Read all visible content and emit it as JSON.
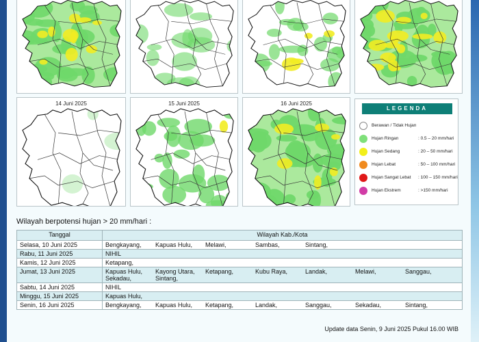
{
  "maps": [
    {
      "id": "m10",
      "date": ""
    },
    {
      "id": "m11",
      "date": ""
    },
    {
      "id": "m12",
      "date": ""
    },
    {
      "id": "m13",
      "date": ""
    },
    {
      "id": "m14",
      "date": "14 Juni 2025"
    },
    {
      "id": "m15",
      "date": "15 Juni 2025"
    },
    {
      "id": "m16",
      "date": "16 Juni 2025"
    }
  ],
  "legend": {
    "title": "LEGENDA",
    "items": [
      {
        "label": "Berawan / Tidak Hujan",
        "range": "",
        "color": "#ffffff"
      },
      {
        "label": "Hujan Ringan",
        "range": ": 0.5 – 20 mm/hari",
        "color": "#7fe07a"
      },
      {
        "label": "Hujan Sedang",
        "range": ": 20 – 50 mm/hari",
        "color": "#f2ef1a"
      },
      {
        "label": "Hujan Lebat",
        "range": ": 50 – 100 mm/hari",
        "color": "#f08a1e"
      },
      {
        "label": "Hujan Sangat Lebat",
        "range": ": 100 – 150 mm/hari",
        "color": "#e01818"
      },
      {
        "label": "Hujan Ekstrem",
        "range": ": >150 mm/hari",
        "color": "#d13ca6"
      }
    ]
  },
  "section_title": "Wilayah berpotensi hujan > 20 mm/hari :",
  "table": {
    "headers": [
      "Tanggal",
      "Wilayah Kab./Kota"
    ],
    "rows": [
      {
        "date": "Selasa, 10 Juni 2025",
        "regions": [
          "Bengkayang,",
          "Kapuas Hulu,",
          "Melawi,",
          "Sambas,",
          "Sintang,"
        ]
      },
      {
        "date": "Rabu, 11 Juni 2025",
        "regions": [
          "NIHIL"
        ]
      },
      {
        "date": "Kamis, 12 Juni 2025",
        "regions": [
          "Ketapang,"
        ]
      },
      {
        "date": "Jumat, 13 Juni 2025",
        "regions": [
          "Kapuas Hulu,",
          "Kayong Utara,",
          "Ketapang,",
          "Kubu Raya,",
          "Landak,",
          "Melawi,",
          "Sanggau,",
          "Sekadau,",
          "Sintang,"
        ]
      },
      {
        "date": "Sabtu, 14 Juni 2025",
        "regions": [
          "NIHIL"
        ]
      },
      {
        "date": "Minggu, 15 Juni 2025",
        "regions": [
          "Kapuas Hulu,"
        ]
      },
      {
        "date": "Senin, 16 Juni 2025",
        "regions": [
          "Bengkayang,",
          "Kapuas Hulu,",
          "Ketapang,",
          "Landak,",
          "Sanggau,",
          "Sekadau,",
          "Sintang,"
        ]
      }
    ]
  },
  "footer": "Update data Senin, 9 Juni 2025 Pukul 16.00 WIB"
}
